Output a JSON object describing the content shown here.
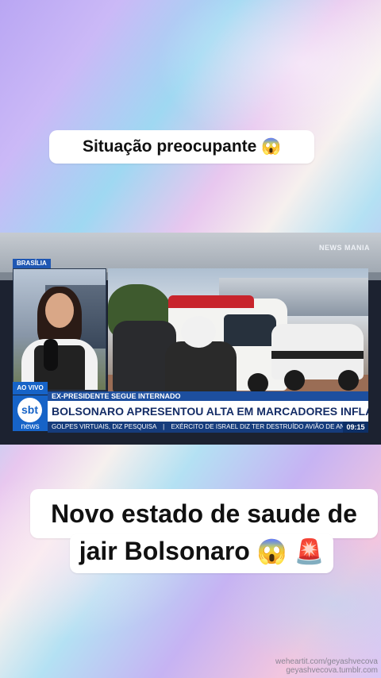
{
  "captions": {
    "top": "Situação preocupante",
    "top_emoji": "😱",
    "bottom_line1": "Novo estado de saude de",
    "bottom_line2": "jair Bolsonaro",
    "bottom_emoji1": "😱",
    "bottom_emoji2": "🚨"
  },
  "broadcast": {
    "channel_watermark": "NEWS MANIA",
    "location": "BRASÍLIA",
    "live_label": "AO VIVO",
    "logo_text": "sbt",
    "logo_sub": "news",
    "kicker": "EX-PRESIDENTE SEGUE INTERNADO",
    "headline": "BOLSONARO APRESENTOU ALTA EM MARCADORES INFLAMATÓRIOS",
    "ticker_1": "GOLPES VIRTUAIS, DIZ PESQUISA",
    "ticker_separator": "|",
    "ticker_2": "EXÉRCITO DE ISRAEL DIZ TER DESTRUÍDO AVIÃO DE ANTIGO LÍDER SUPREMO",
    "clock": "09:15"
  },
  "watermark": {
    "line1": "weheartit.com/geyashvecova",
    "line2": "geyashvecova.tumblr.com"
  },
  "colors": {
    "sbt_blue": "#1663c7",
    "headline_text": "#152d66",
    "siren_red": "#d7192a"
  }
}
